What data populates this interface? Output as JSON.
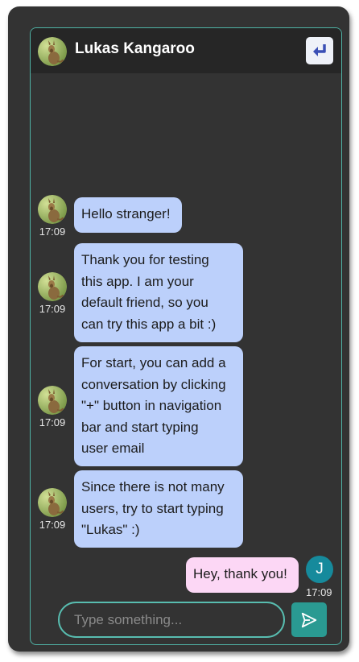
{
  "header": {
    "title": "Lukas Kangaroo",
    "avatar_icon": "kangaroo-avatar-icon",
    "back_icon": "return-arrow-icon"
  },
  "messages": [
    {
      "text": "Hello stranger!",
      "time": "17:09",
      "from": "friend"
    },
    {
      "text": "Thank you for testing\nthis app. I am your\ndefault friend, so you\ncan try this app a bit :)",
      "time": "17:09",
      "from": "friend"
    },
    {
      "text": "For start, you can add a\nconversation by clicking\n\"+\" button in navigation\nbar and start typing\nuser email",
      "time": "17:09",
      "from": "friend"
    },
    {
      "text": "Since there is not many\nusers, try to start typing\n\"Lukas\" :)",
      "time": "17:09",
      "from": "friend"
    },
    {
      "text": "Hey, thank you!",
      "time": "17:09",
      "from": "me",
      "avatar_letter": "J"
    }
  ],
  "composer": {
    "placeholder": "Type something...",
    "send_icon": "send-icon"
  },
  "colors": {
    "friend_bubble": "#bcd0fb",
    "my_bubble": "#fcd7f5",
    "accent": "#2a9a92",
    "background": "#333333"
  }
}
